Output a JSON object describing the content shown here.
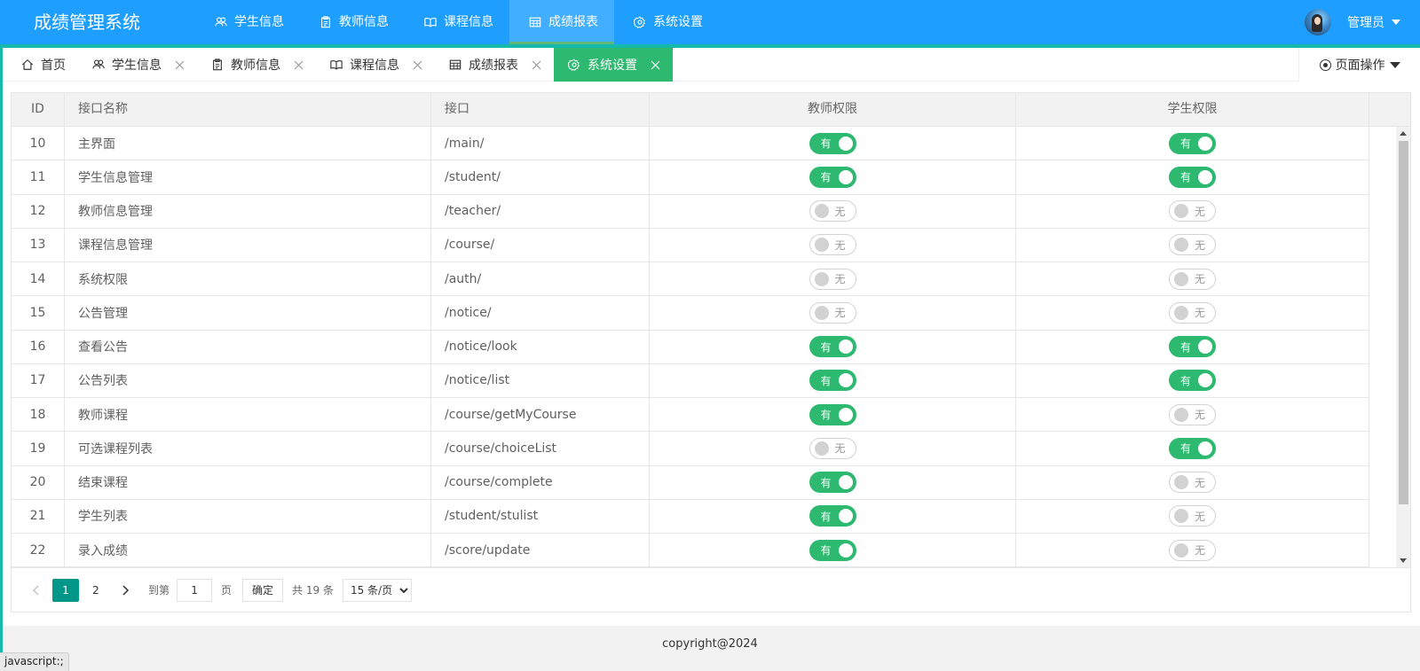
{
  "app": {
    "title": "成绩管理系统"
  },
  "topnav": [
    {
      "label": "学生信息",
      "icon": "users-icon",
      "active": false
    },
    {
      "label": "教师信息",
      "icon": "clipboard-icon",
      "active": false
    },
    {
      "label": "课程信息",
      "icon": "book-icon",
      "active": false
    },
    {
      "label": "成绩报表",
      "icon": "table-icon",
      "active": true
    },
    {
      "label": "系统设置",
      "icon": "gear-icon",
      "active": false
    }
  ],
  "user": {
    "name": "管理员"
  },
  "tabs": [
    {
      "label": "首页",
      "icon": "home-icon",
      "closable": false,
      "active": false
    },
    {
      "label": "学生信息",
      "icon": "users-icon",
      "closable": true,
      "active": false
    },
    {
      "label": "教师信息",
      "icon": "clipboard-icon",
      "closable": true,
      "active": false
    },
    {
      "label": "课程信息",
      "icon": "book-icon",
      "closable": true,
      "active": false
    },
    {
      "label": "成绩报表",
      "icon": "table-icon",
      "closable": true,
      "active": false
    },
    {
      "label": "系统设置",
      "icon": "gear-icon",
      "closable": true,
      "active": true
    }
  ],
  "page_ops": {
    "label": "页面操作"
  },
  "table": {
    "headers": [
      "ID",
      "接口名称",
      "接口",
      "教师权限",
      "学生权限"
    ],
    "on_label": "有",
    "off_label": "无",
    "rows": [
      {
        "id": "10",
        "name": "主界面",
        "api": "/main/",
        "teacher": true,
        "student": true
      },
      {
        "id": "11",
        "name": "学生信息管理",
        "api": "/student/",
        "teacher": true,
        "student": true
      },
      {
        "id": "12",
        "name": "教师信息管理",
        "api": "/teacher/",
        "teacher": false,
        "student": false
      },
      {
        "id": "13",
        "name": "课程信息管理",
        "api": "/course/",
        "teacher": false,
        "student": false
      },
      {
        "id": "14",
        "name": "系统权限",
        "api": "/auth/",
        "teacher": false,
        "student": false
      },
      {
        "id": "15",
        "name": "公告管理",
        "api": "/notice/",
        "teacher": false,
        "student": false
      },
      {
        "id": "16",
        "name": "查看公告",
        "api": "/notice/look",
        "teacher": true,
        "student": true
      },
      {
        "id": "17",
        "name": "公告列表",
        "api": "/notice/list",
        "teacher": true,
        "student": true
      },
      {
        "id": "18",
        "name": "教师课程",
        "api": "/course/getMyCourse",
        "teacher": true,
        "student": false
      },
      {
        "id": "19",
        "name": "可选课程列表",
        "api": "/course/choiceList",
        "teacher": false,
        "student": true
      },
      {
        "id": "20",
        "name": "结束课程",
        "api": "/course/complete",
        "teacher": true,
        "student": false
      },
      {
        "id": "21",
        "name": "学生列表",
        "api": "/student/stulist",
        "teacher": true,
        "student": false
      },
      {
        "id": "22",
        "name": "录入成绩",
        "api": "/score/update",
        "teacher": true,
        "student": false
      }
    ]
  },
  "pager": {
    "pages": [
      "1",
      "2"
    ],
    "current": "1",
    "goto_label": "到第",
    "goto_value": "1",
    "page_unit": "页",
    "confirm_label": "确定",
    "total_label": "共 19 条",
    "page_size_options": [
      "15 条/页"
    ],
    "page_size_selected": "15 条/页"
  },
  "footer": {
    "text": "copyright@2024"
  },
  "statusbar": {
    "text": "javascript:;"
  },
  "colors": {
    "header": "#1e9fff",
    "accent": "#16baaa",
    "switch_on": "#2db96f",
    "current_page": "#009688"
  }
}
